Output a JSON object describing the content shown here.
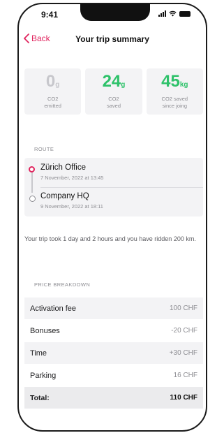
{
  "status_bar": {
    "time": "9:41"
  },
  "nav": {
    "back_label": "Back",
    "title": "Your trip summary"
  },
  "stats": [
    {
      "value": "0",
      "unit": "g",
      "label_line1": "CO2",
      "label_line2": "emitted",
      "color": "#c7c7cc"
    },
    {
      "value": "24",
      "unit": "g",
      "label_line1": "CO2",
      "label_line2": "saved",
      "color": "#2ec26a"
    },
    {
      "value": "45",
      "unit": "kg",
      "label_line1": "CO2 saved",
      "label_line2": "since joing",
      "color": "#2ec26a"
    }
  ],
  "route": {
    "section_label": "ROUTE",
    "stops": [
      {
        "name": "Zürich Office",
        "date": "7 November, 2022 at 13:45"
      },
      {
        "name": "Company HQ",
        "date": "9 November, 2022 at 18:11"
      }
    ],
    "summary": "Your trip took 1 day and 2 hours and you have ridden 200 km."
  },
  "price": {
    "section_label": "PRICE BREAKDOWN",
    "rows": [
      {
        "label": "Activation fee",
        "value": "100 CHF"
      },
      {
        "label": "Bonuses",
        "value": "-20 CHF"
      },
      {
        "label": "Time",
        "value": "+30 CHF"
      },
      {
        "label": "Parking",
        "value": "16 CHF"
      }
    ],
    "total": {
      "label": "Total:",
      "value": "110 CHF"
    }
  },
  "colors": {
    "accent": "#e0245e",
    "green": "#2ec26a",
    "muted": "#8e8e93"
  }
}
